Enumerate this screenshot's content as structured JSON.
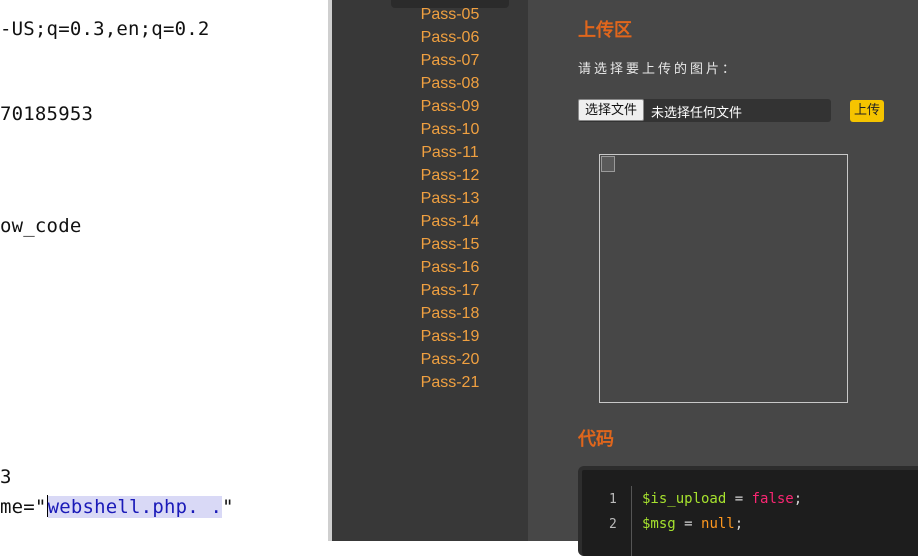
{
  "request_pane": {
    "lines": [
      "-US;q=0.3,en;q=0.2",
      "70185953",
      "ow_code",
      "3"
    ],
    "filename_prefix": "me=\"",
    "filename_selected": "webshell.php. .",
    "filename_suffix": "\""
  },
  "sidebar": {
    "items": [
      "Pass-05",
      "Pass-06",
      "Pass-07",
      "Pass-08",
      "Pass-09",
      "Pass-10",
      "Pass-11",
      "Pass-12",
      "Pass-13",
      "Pass-14",
      "Pass-15",
      "Pass-16",
      "Pass-17",
      "Pass-18",
      "Pass-19",
      "Pass-20",
      "Pass-21"
    ]
  },
  "upload_section": {
    "title": "上传区",
    "select_label": "请选择要上传的图片：",
    "choose_file_button": "选择文件",
    "file_status": "未选择任何文件",
    "upload_button": "上传"
  },
  "code_section": {
    "title": "代码",
    "line_numbers": [
      "1",
      "2"
    ],
    "line1_var": "$is_upload",
    "line1_op": " = ",
    "line1_val": "false",
    "line1_end": ";",
    "line2_var": "$msg",
    "line2_op": " = ",
    "line2_val": "null",
    "line2_end": ";"
  },
  "colors": {
    "nav_link": "#f0a040",
    "section_title": "#e0661c",
    "upload_button": "#f5c400"
  }
}
